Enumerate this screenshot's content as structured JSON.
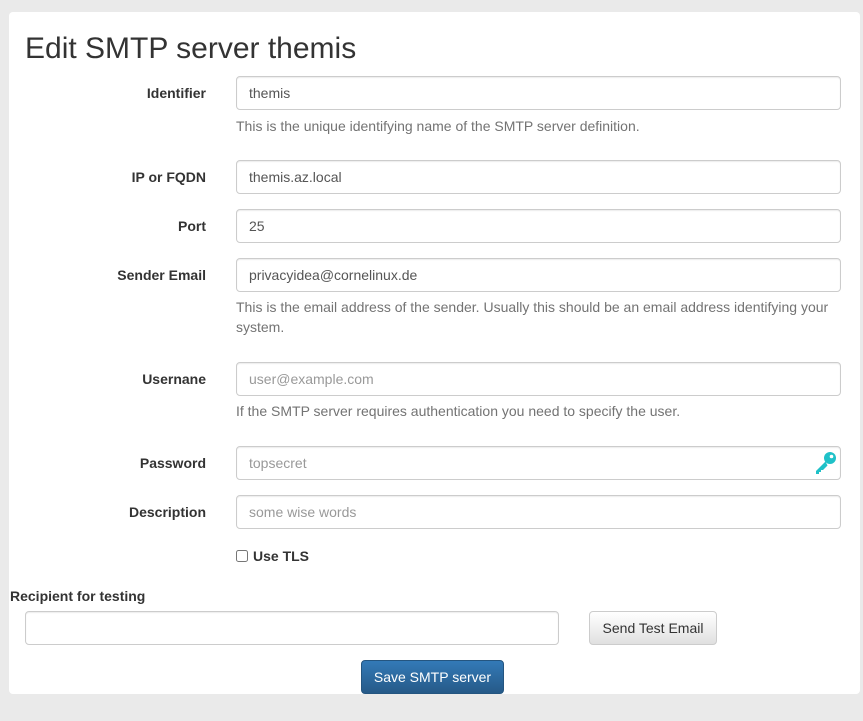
{
  "page": {
    "title": "Edit SMTP server themis"
  },
  "form": {
    "identifier": {
      "label": "Identifier",
      "value": "themis",
      "help": "This is the unique identifying name of the SMTP server definition."
    },
    "server": {
      "label": "IP or FQDN",
      "value": "themis.az.local"
    },
    "port": {
      "label": "Port",
      "value": "25"
    },
    "sender": {
      "label": "Sender Email",
      "value": "privacyidea@cornelinux.de",
      "help": "This is the email address of the sender. Usually this should be an email address identifying your system."
    },
    "username": {
      "label": "Usernane",
      "value": "",
      "placeholder": "user@example.com",
      "help": "If the SMTP server requires authentication you need to specify the user."
    },
    "password": {
      "label": "Password",
      "value": "",
      "placeholder": "topsecret",
      "icon": "key-icon"
    },
    "description": {
      "label": "Description",
      "value": "",
      "placeholder": "some wise words"
    },
    "tls": {
      "label": "Use TLS",
      "checked": false
    }
  },
  "testing": {
    "label": "Recipient for testing",
    "value": "",
    "button_label": "Send Test Email"
  },
  "actions": {
    "save_label": "Save SMTP server"
  },
  "colors": {
    "primary": "#337ab7",
    "key_icon": "#1fc1c8",
    "background": "#eaeaea"
  }
}
